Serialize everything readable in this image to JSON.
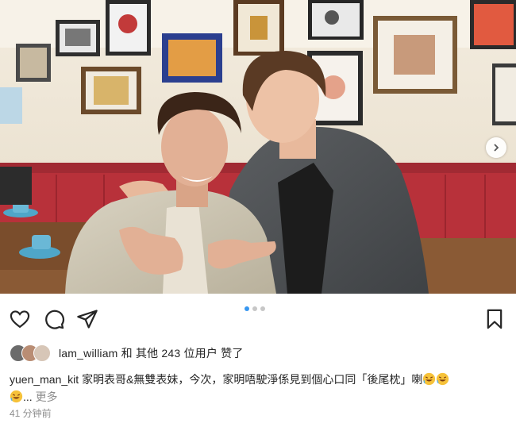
{
  "post": {
    "image_alt": "",
    "carousel": {
      "total": 3,
      "active": 1
    }
  },
  "actions": {
    "like_icon": "heart-icon",
    "comment_icon": "comment-icon",
    "share_icon": "send-icon",
    "save_icon": "bookmark-icon",
    "next_icon": "chevron-right-icon"
  },
  "likes": {
    "first_user": "lam_william",
    "connector": "和",
    "others_label": "其他 243 位用户",
    "liked_label": "赞了"
  },
  "caption": {
    "username": "yuen_man_kit",
    "text": "家明表哥&無雙表妹，今次，家明唔駛淨係見到個心口同「後尾枕」喇",
    "ellipsis": "...",
    "more_label": "更多"
  },
  "timestamp": "41 分钟前",
  "colors": {
    "accent": "#3897f0",
    "text": "#262626",
    "muted": "#8e8e8e",
    "booth_red": "#b8313a"
  }
}
